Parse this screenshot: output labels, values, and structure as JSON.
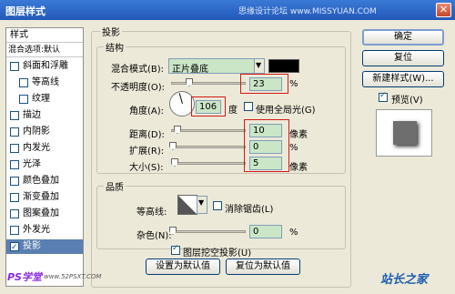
{
  "window": {
    "title": "图层样式",
    "watermark": "思缘设计论坛 www.MISSYUAN.COM",
    "close_glyph": "✕"
  },
  "sidebar": {
    "header": "样式",
    "blend_options": "混合选项:默认",
    "items": [
      {
        "label": "斜面和浮雕",
        "checked": false
      },
      {
        "label": "等高线",
        "checked": false
      },
      {
        "label": "纹理",
        "checked": false
      },
      {
        "label": "描边",
        "checked": false
      },
      {
        "label": "内阴影",
        "checked": false
      },
      {
        "label": "内发光",
        "checked": false
      },
      {
        "label": "光泽",
        "checked": false
      },
      {
        "label": "颜色叠加",
        "checked": false
      },
      {
        "label": "渐变叠加",
        "checked": false
      },
      {
        "label": "图案叠加",
        "checked": false
      },
      {
        "label": "外发光",
        "checked": false
      },
      {
        "label": "投影",
        "checked": true
      }
    ]
  },
  "panel": {
    "title": "投影",
    "structure_title": "结构",
    "blend_mode_label": "混合模式(B):",
    "blend_mode_value": "正片叠底",
    "shadow_color": "#000000",
    "opacity_label": "不透明度(O):",
    "opacity_value": "23",
    "opacity_unit": "%",
    "angle_label": "角度(A):",
    "angle_value": "106",
    "angle_unit": "度",
    "global_light_label": "使用全局光(G)",
    "global_light_checked": false,
    "distance_label": "距离(D):",
    "distance_value": "10",
    "distance_unit": "像素",
    "spread_label": "扩展(R):",
    "spread_value": "0",
    "spread_unit": "%",
    "size_label": "大小(S):",
    "size_value": "5",
    "size_unit": "像素",
    "quality_title": "品质",
    "contour_label": "等高线:",
    "antialias_label": "消除锯齿(L)",
    "antialias_checked": false,
    "noise_label": "杂色(N):",
    "noise_value": "0",
    "noise_unit": "%",
    "knockout_label": "图层挖空投影(U)",
    "knockout_checked": true,
    "make_default_label": "设置为默认值",
    "reset_default_label": "复位为默认值"
  },
  "buttons": {
    "ok": "确定",
    "reset": "复位",
    "new_style": "新建样式(W)...",
    "preview_label": "预览(V)",
    "preview_checked": true
  },
  "footer": {
    "left_logo": "PS学堂",
    "left_url": "www.52PSXT.COM",
    "right_logo": "站长之家"
  },
  "colors": {
    "highlight_red": "#d21a1a",
    "field_green": "#cbe6c7",
    "selected_blue": "#5a7fb2",
    "titlebar_blue": "#2458b8"
  }
}
